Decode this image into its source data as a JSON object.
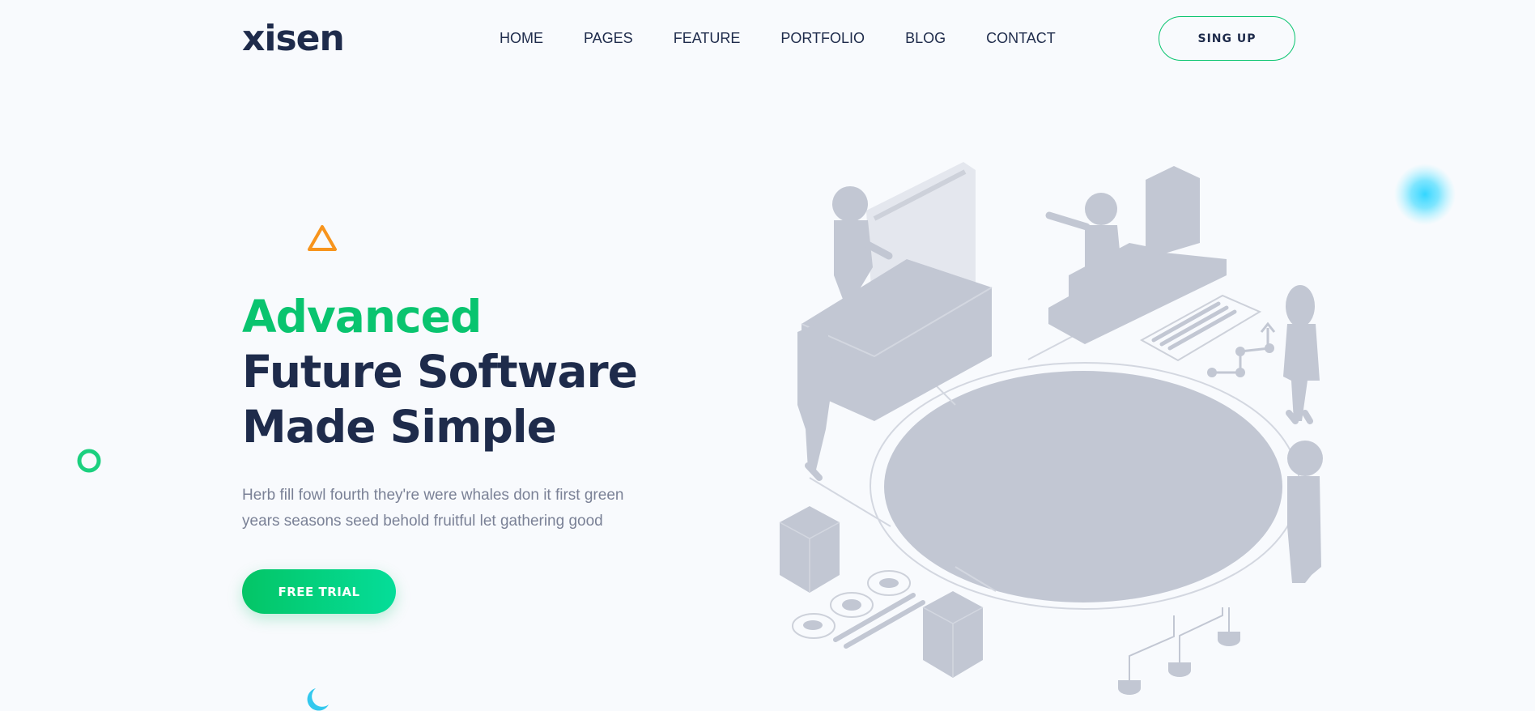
{
  "header": {
    "logo": "xisen",
    "nav": [
      "HOME",
      "PAGES",
      "FEATURE",
      "PORTFOLIO",
      "BLOG",
      "CONTACT"
    ],
    "signup_label": "SING UP"
  },
  "hero": {
    "title_line1": "Advanced",
    "title_line2": "Future Software",
    "title_line3": "Made Simple",
    "description": "Herb fill fowl fourth they're were whales don it first green years seasons seed behold fruitful let gathering good",
    "cta_label": "FREE TRIAL"
  },
  "colors": {
    "accent_green": "#09c46f",
    "heading_navy": "#1e2b4b",
    "illustration_gray": "#c2c7d3",
    "triangle_orange": "#f7941d",
    "glow_cyan": "#33d6ff"
  },
  "icons": [
    "triangle-shape-icon",
    "ring-shape-icon",
    "crescent-shape-icon",
    "glow-dot-icon"
  ]
}
